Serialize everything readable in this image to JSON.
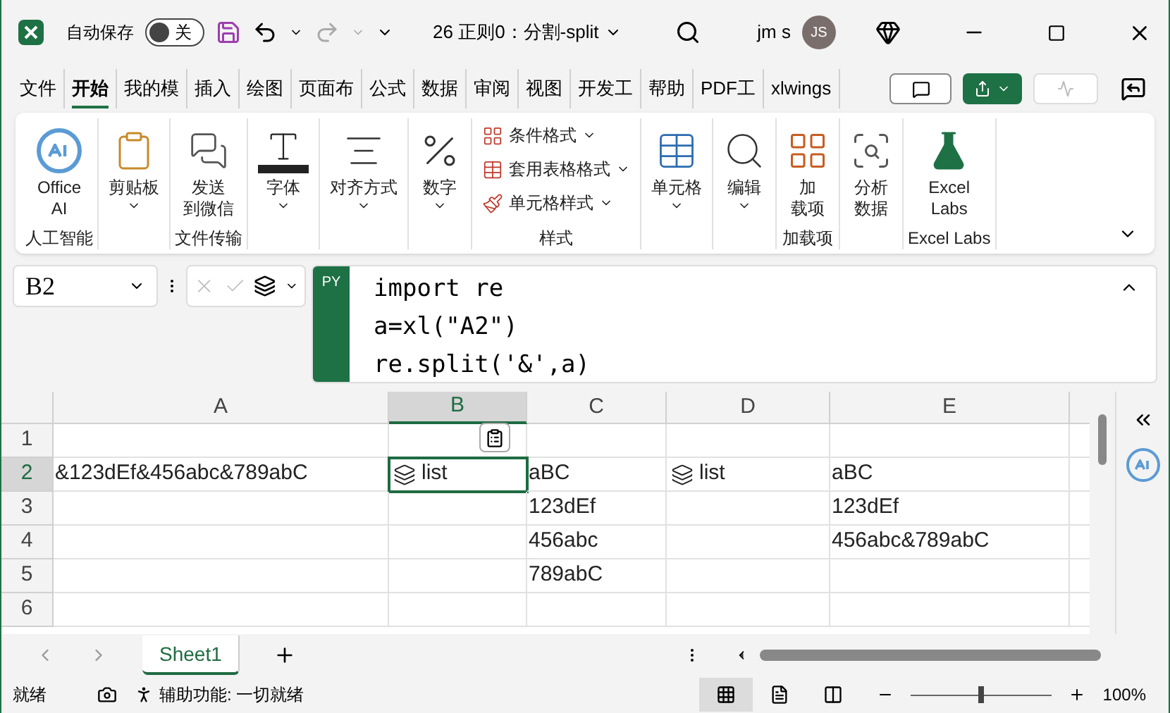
{
  "titlebar": {
    "autosave_label": "自动保存",
    "autosave": {
      "on": false,
      "label": "关"
    },
    "doc_title": "26 正则0：分割-split",
    "user": "jm s",
    "avatar": "JS"
  },
  "tabs": [
    {
      "label": "文件",
      "selected": false
    },
    {
      "label": "开始",
      "selected": true
    },
    {
      "label": "我的模",
      "selected": false
    },
    {
      "label": "插入",
      "selected": false
    },
    {
      "label": "绘图",
      "selected": false
    },
    {
      "label": "页面布",
      "selected": false
    },
    {
      "label": "公式",
      "selected": false
    },
    {
      "label": "数据",
      "selected": false
    },
    {
      "label": "审阅",
      "selected": false
    },
    {
      "label": "视图",
      "selected": false
    },
    {
      "label": "开发工",
      "selected": false
    },
    {
      "label": "帮助",
      "selected": false
    },
    {
      "label": "PDF工",
      "selected": false
    },
    {
      "label": "xlwings",
      "selected": false
    }
  ],
  "ribbon": [
    {
      "label": "人工智能",
      "items": [
        {
          "kind": "large",
          "lines": [
            "Office",
            "AI"
          ],
          "dropdown": false
        }
      ]
    },
    {
      "items": [
        {
          "kind": "large",
          "lines": [
            "剪贴板"
          ],
          "dropdown": true
        }
      ]
    },
    {
      "label": "文件传输",
      "items": [
        {
          "kind": "large",
          "lines": [
            "发送",
            "到微信"
          ],
          "dropdown": false
        }
      ]
    },
    {
      "items": [
        {
          "kind": "large",
          "lines": [
            "字体"
          ],
          "dropdown": true
        }
      ]
    },
    {
      "items": [
        {
          "kind": "large",
          "lines": [
            "对齐方式"
          ],
          "dropdown": true
        }
      ]
    },
    {
      "items": [
        {
          "kind": "large",
          "lines": [
            "数字"
          ],
          "dropdown": true
        }
      ]
    },
    {
      "label": "样式",
      "items": [
        {
          "kind": "small",
          "lines": [
            "条件格式"
          ],
          "dropdown": true
        },
        {
          "kind": "small",
          "lines": [
            "套用表格格式"
          ],
          "dropdown": true
        },
        {
          "kind": "small",
          "lines": [
            "单元格样式"
          ],
          "dropdown": true
        }
      ]
    },
    {
      "items": [
        {
          "kind": "large",
          "lines": [
            "单元格"
          ],
          "dropdown": true
        }
      ]
    },
    {
      "items": [
        {
          "kind": "large",
          "lines": [
            "编辑"
          ],
          "dropdown": true
        }
      ]
    },
    {
      "label": "加载项",
      "items": [
        {
          "kind": "large",
          "lines": [
            "加",
            "载项"
          ],
          "dropdown": false
        }
      ]
    },
    {
      "items": [
        {
          "kind": "large",
          "lines": [
            "分析",
            "数据"
          ],
          "dropdown": false
        }
      ]
    },
    {
      "label": "Excel Labs",
      "items": [
        {
          "kind": "large",
          "lines": [
            "Excel",
            "Labs"
          ],
          "dropdown": false
        }
      ]
    }
  ],
  "formula_bar": {
    "name_box": "B2",
    "badge": "PY",
    "code": [
      "import re",
      "a=xl(\"A2\")",
      "re.split('&',a)"
    ]
  },
  "grid": {
    "columns": [
      {
        "label": "A",
        "selected": false
      },
      {
        "label": "B",
        "selected": true
      },
      {
        "label": "C",
        "selected": false
      },
      {
        "label": "D",
        "selected": false
      },
      {
        "label": "E",
        "selected": false
      }
    ],
    "rows": [
      {
        "label": "1",
        "selected": false,
        "cells": []
      },
      {
        "label": "2",
        "selected": true,
        "cells": [
          {
            "kind": "text",
            "text": "&123dEf&456abc&789abC"
          },
          {
            "kind": "spill",
            "text": "list",
            "selected": true
          },
          {
            "kind": "text",
            "text": "aBC"
          },
          {
            "kind": "spill",
            "text": "list",
            "selected": false
          },
          {
            "kind": "text",
            "text": "aBC"
          }
        ]
      },
      {
        "label": "3",
        "selected": false,
        "cells": [
          {
            "kind": "empty"
          },
          {
            "kind": "empty"
          },
          {
            "kind": "text",
            "text": "123dEf"
          },
          {
            "kind": "empty"
          },
          {
            "kind": "text",
            "text": "123dEf"
          }
        ]
      },
      {
        "label": "4",
        "selected": false,
        "cells": [
          {
            "kind": "empty"
          },
          {
            "kind": "empty"
          },
          {
            "kind": "text",
            "text": "456abc"
          },
          {
            "kind": "empty"
          },
          {
            "kind": "text",
            "text": "456abc&789abC"
          }
        ]
      },
      {
        "label": "5",
        "selected": false,
        "cells": [
          {
            "kind": "empty"
          },
          {
            "kind": "empty"
          },
          {
            "kind": "text",
            "text": "789abC"
          },
          {
            "kind": "empty"
          },
          {
            "kind": "empty"
          }
        ]
      },
      {
        "label": "6",
        "selected": false,
        "cells": []
      }
    ]
  },
  "sheets": [
    {
      "label": "Sheet1",
      "selected": true
    }
  ],
  "status_bar": {
    "ready": "就绪",
    "accessibility": "辅助功能: 一切就绪",
    "views": [
      {
        "selected": true
      },
      {
        "selected": false
      },
      {
        "selected": false
      }
    ],
    "zoom": {
      "level": 0.5,
      "label": "100%"
    }
  }
}
